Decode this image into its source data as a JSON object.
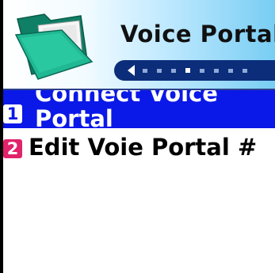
{
  "header": {
    "title": "Voice Portal",
    "scroller": {
      "total_pages": 8,
      "active_page": 4
    }
  },
  "menu": {
    "items": [
      {
        "number": "1",
        "label": "Connect Voice Portal",
        "selected": true
      },
      {
        "number": "2",
        "label": "Edit Voie Portal #",
        "selected": false
      }
    ]
  },
  "colors": {
    "selection": "#0a18e8",
    "scroller": "#0b2d7a",
    "badge_unselected": "#e0236b",
    "folder": "#1aa88a"
  }
}
